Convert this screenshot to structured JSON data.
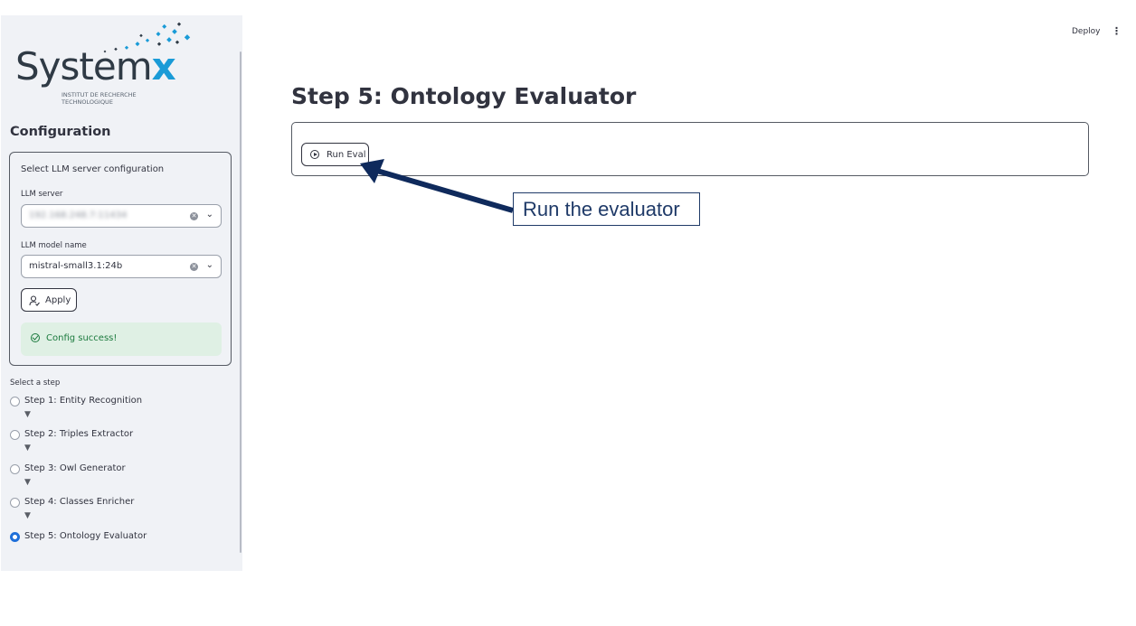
{
  "topbar": {
    "deploy_label": "Deploy",
    "menu_icon": "more-vertical-icon",
    "menu_glyph": "⋮"
  },
  "sidebar": {
    "logo": {
      "word": "System",
      "x": "x",
      "subtitle_line1": "INSTITUT DE RECHERCHE",
      "subtitle_line2": "TECHNOLOGIQUE"
    },
    "title": "Configuration",
    "config": {
      "heading": "Select LLM server configuration",
      "server_label": "LLM server",
      "server_value": "192.168.248.7:11434",
      "model_label": "LLM model name",
      "model_value": "mistral-small3.1:24b",
      "apply_label": "Apply",
      "success_text": "Config success!"
    },
    "steps_label": "Select a step",
    "steps": [
      {
        "label": "Step 1: Entity Recognition",
        "selected": false
      },
      {
        "label": "Step 2: Triples Extractor",
        "selected": false
      },
      {
        "label": "Step 3: Owl Generator",
        "selected": false
      },
      {
        "label": "Step 4: Classes Enricher",
        "selected": false
      },
      {
        "label": "Step 5: Ontology Evaluator",
        "selected": true
      }
    ],
    "step_arrow": "▼"
  },
  "main": {
    "title": "Step 5: Ontology Evaluator",
    "run_button_label": "Run Eval"
  },
  "annotation": {
    "text": "Run the evaluator",
    "color": "#0f2a5c"
  },
  "colors": {
    "sidebar_bg": "#f0f2f6",
    "accent": "#1e6fd9",
    "logo_accent": "#1a9bd7",
    "success_bg": "#dff0e4",
    "success_text": "#1c7a3e"
  }
}
